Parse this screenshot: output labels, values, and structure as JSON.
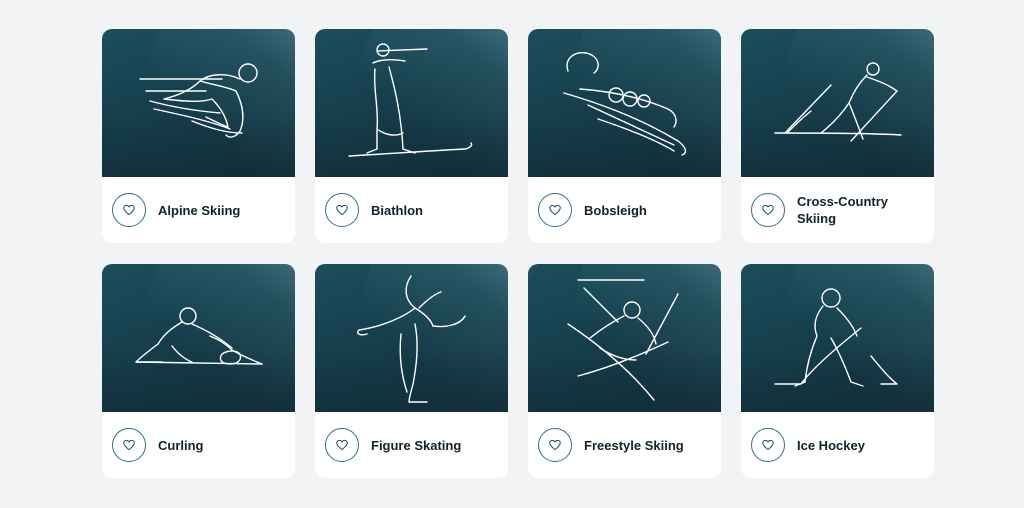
{
  "sports": [
    {
      "name": "Alpine Skiing",
      "icon": "alpine-skiing-pictogram"
    },
    {
      "name": "Biathlon",
      "icon": "biathlon-pictogram"
    },
    {
      "name": "Bobsleigh",
      "icon": "bobsleigh-pictogram"
    },
    {
      "name": "Cross-Country Skiing",
      "icon": "cross-country-skiing-pictogram"
    },
    {
      "name": "Curling",
      "icon": "curling-pictogram"
    },
    {
      "name": "Figure Skating",
      "icon": "figure-skating-pictogram"
    },
    {
      "name": "Freestyle Skiing",
      "icon": "freestyle-skiing-pictogram"
    },
    {
      "name": "Ice Hockey",
      "icon": "ice-hockey-pictogram"
    }
  ],
  "favorite_icon": "heart-outline-icon",
  "colors": {
    "page_background": "#f2f3f5",
    "card_background": "#ffffff",
    "art_background": "#163e4c",
    "label_text": "#10222b",
    "favorite_border": "#2f6f8c"
  }
}
